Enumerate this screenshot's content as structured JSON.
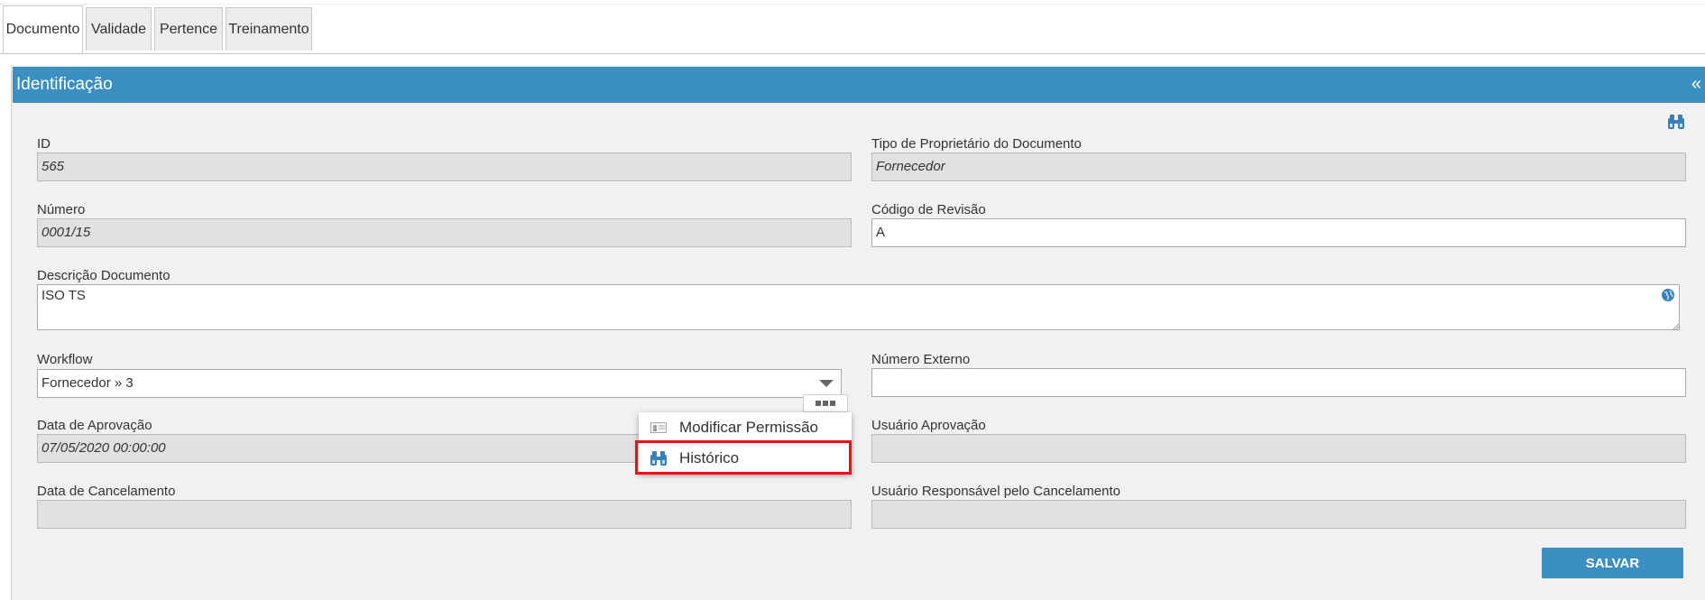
{
  "tabs": [
    "Documento",
    "Validade",
    "Pertence",
    "Treinamento"
  ],
  "panel": {
    "title": "Identificação",
    "collapse": "«"
  },
  "fields": {
    "id": {
      "label": "ID",
      "value": "565"
    },
    "owner_type": {
      "label": "Tipo de Proprietário do Documento",
      "value": "Fornecedor"
    },
    "numero": {
      "label": "Número",
      "value": "0001/15"
    },
    "revisao": {
      "label": "Código de Revisão",
      "value": "A"
    },
    "descricao": {
      "label": "Descrição Documento",
      "value": "ISO TS"
    },
    "workflow": {
      "label": "Workflow",
      "value": "Fornecedor » 3"
    },
    "numero_externo": {
      "label": "Número Externo",
      "value": ""
    },
    "data_aprovacao": {
      "label": "Data de Aprovação",
      "value": "07/05/2020 00:00:00"
    },
    "usuario_aprovacao": {
      "label": "Usuário Aprovação",
      "value": ""
    },
    "data_cancelamento": {
      "label": "Data de Cancelamento",
      "value": ""
    },
    "usuario_cancelamento": {
      "label": "Usuário Responsável pelo Cancelamento",
      "value": ""
    }
  },
  "context_menu": {
    "items": [
      {
        "label": "Modificar Permissão",
        "icon": "permission-card-icon"
      },
      {
        "label": "Histórico",
        "icon": "binoculars-icon"
      }
    ]
  },
  "actions": {
    "save": "SALVAR"
  },
  "colors": {
    "header": "#3b8fc1",
    "highlight": "#e5141b",
    "button": "#3b8fc1"
  }
}
